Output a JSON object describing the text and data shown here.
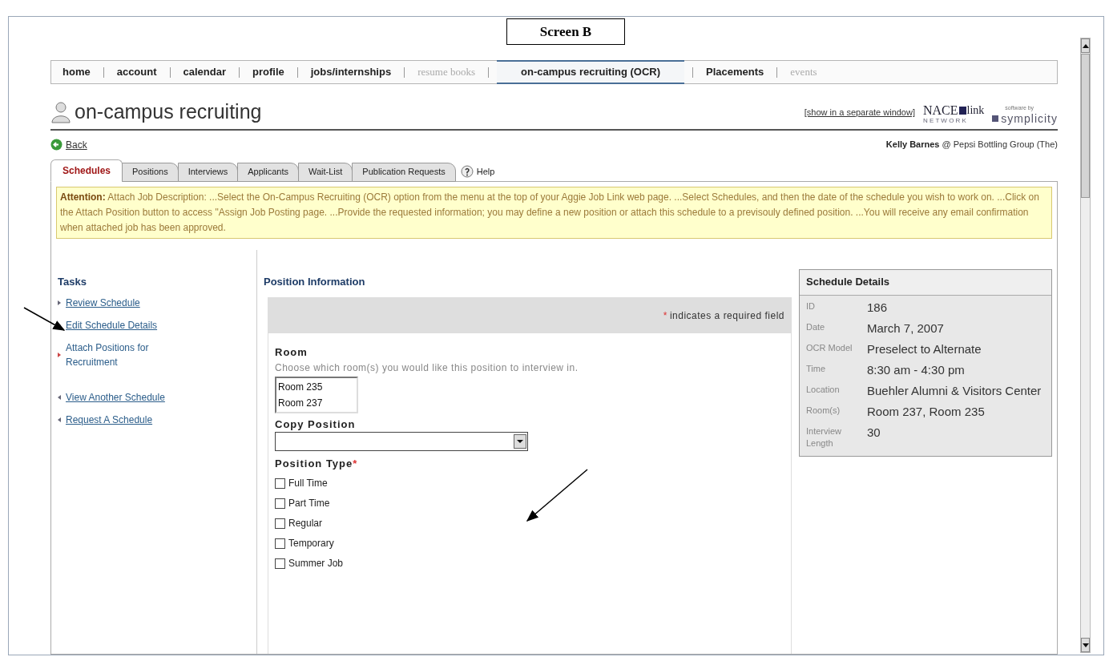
{
  "caption": "Screen B",
  "nav": [
    {
      "label": "home",
      "selected": false,
      "disabled": false
    },
    {
      "label": "account",
      "selected": false,
      "disabled": false
    },
    {
      "label": "calendar",
      "selected": false,
      "disabled": false
    },
    {
      "label": "profile",
      "selected": false,
      "disabled": false
    },
    {
      "label": "jobs/internships",
      "selected": false,
      "disabled": false
    },
    {
      "label": "resume books",
      "selected": false,
      "disabled": true
    },
    {
      "label": "on-campus recruiting (OCR)",
      "selected": true,
      "disabled": false
    },
    {
      "label": "Placements",
      "selected": false,
      "disabled": false
    },
    {
      "label": "events",
      "selected": false,
      "disabled": true
    }
  ],
  "page_title": "on-campus recruiting",
  "separate_window_link": "[show in a separate window]",
  "brand": {
    "nace": "NACE",
    "nace_link": "link",
    "network": "N E T W O R K",
    "software_by": "software by",
    "symplicity": "symplicity"
  },
  "back_link": "Back",
  "user": {
    "name": "Kelly Barnes",
    "org": "@ Pepsi Bottling Group (The)"
  },
  "tabs": [
    {
      "label": "Schedules",
      "selected": true
    },
    {
      "label": "Positions",
      "selected": false
    },
    {
      "label": "Interviews",
      "selected": false
    },
    {
      "label": "Applicants",
      "selected": false
    },
    {
      "label": "Wait-List",
      "selected": false
    },
    {
      "label": "Publication Requests",
      "selected": false
    }
  ],
  "help_link": "Help",
  "attention": "**Attention:** Attach Job Description: ...Select the On-Campus Recruiting (OCR) option from the menu at the top of your Aggie Job Link web page. ...Select Schedules, and then the date of the schedule you wish to work on. ...Click on the Attach Position button to access \"Assign Job Posting page. ...Provide the requested information; you may define a new position or attach this schedule to a previsouly defined position. ...You will receive any email confirmation when attached job has been approved.",
  "tasks": {
    "title": "Tasks",
    "items": [
      {
        "label": "Review Schedule",
        "kind": "forward",
        "selected": false
      },
      {
        "label": "Edit Schedule Details",
        "kind": "forward",
        "selected": false
      },
      {
        "label": "Attach Positions for Recruitment",
        "kind": "forward",
        "selected": true
      },
      {
        "label": "View Another Schedule",
        "kind": "back",
        "selected": false
      },
      {
        "label": "Request A Schedule",
        "kind": "back",
        "selected": false
      }
    ]
  },
  "position": {
    "title": "Position Information",
    "required_note": "indicates a required field",
    "required_mark": "*",
    "room_label": "Room",
    "room_hint": "Choose which room(s) you would like this position to interview in.",
    "rooms": [
      {
        "label": "Room 235",
        "selected": false
      },
      {
        "label": "Room 237",
        "selected": false
      }
    ],
    "copy_label": "Copy Position",
    "type_label": "Position Type",
    "types": [
      {
        "label": "Full Time",
        "checked": false
      },
      {
        "label": "Part Time",
        "checked": false
      },
      {
        "label": "Regular",
        "checked": false
      },
      {
        "label": "Temporary",
        "checked": false
      },
      {
        "label": "Summer Job",
        "checked": false
      }
    ]
  },
  "schedule_details": {
    "title": "Schedule Details",
    "rows": [
      {
        "label": "ID",
        "value": "186"
      },
      {
        "label": "Date",
        "value": "March 7, 2007"
      },
      {
        "label": "OCR Model",
        "value": "Preselect to Alternate"
      },
      {
        "label": "Time",
        "value": "8:30 am - 4:30 pm"
      },
      {
        "label": "Location",
        "value": "Buehler Alumni & Visitors Center"
      },
      {
        "label": "Room(s)",
        "value": "Room 237, Room 235"
      },
      {
        "label": "Interview Length",
        "value": "30"
      }
    ]
  }
}
